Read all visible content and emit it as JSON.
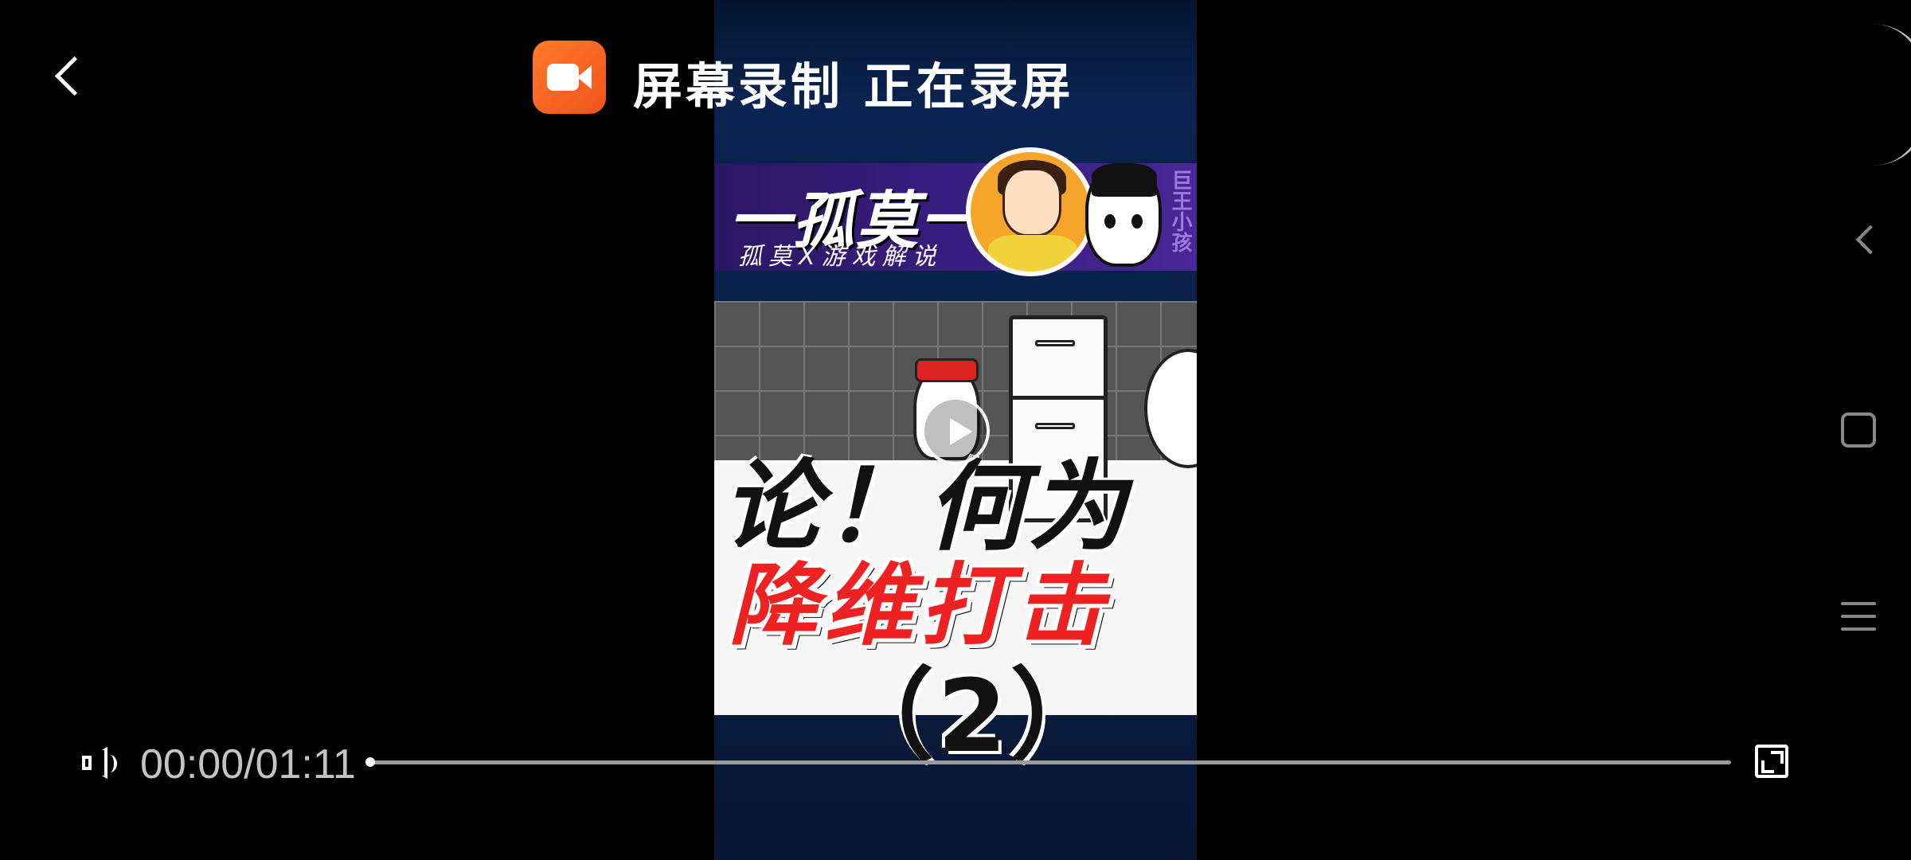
{
  "header": {
    "title": "屏幕录制 正在录屏",
    "app_icon": "video-camera-icon",
    "back_icon": "back-arrow-icon",
    "app_icon_color": "#f26522"
  },
  "video": {
    "banner_title": "一孤莫一",
    "banner_subtitle": "孤莫X游戏解说",
    "banner_side": "巨王小孩",
    "cover_line1": "论！何为",
    "cover_line2": "降维打击",
    "cover_line3": "（2）",
    "play_icon": "play-icon"
  },
  "player": {
    "time_display": "00:00/01:11",
    "progress_fraction": 0,
    "volume_icon": "volume-icon",
    "fullscreen_icon": "fullscreen-icon"
  },
  "system_nav": {
    "back_icon": "nav-back-icon",
    "home_icon": "nav-home-icon",
    "recent_icon": "nav-recent-icon"
  }
}
